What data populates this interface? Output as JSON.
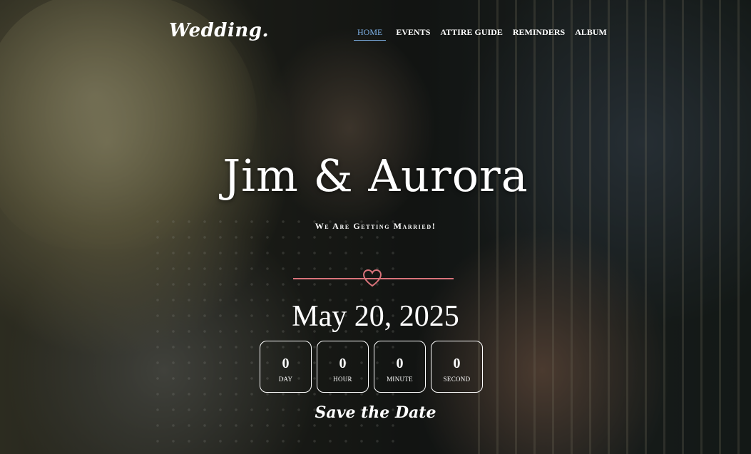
{
  "header": {
    "logo": "Wedding.",
    "nav": [
      {
        "label": "HOME",
        "active": true
      },
      {
        "label": "EVENTS",
        "active": false
      },
      {
        "label": "ATTIRE GUIDE",
        "active": false
      },
      {
        "label": "REMINDERS",
        "active": false
      },
      {
        "label": "ALBUM",
        "active": false
      }
    ]
  },
  "hero": {
    "names": "Jim & Aurora",
    "tagline": "We Are Getting Married!",
    "date": "May 20, 2025",
    "countdown": [
      {
        "value": "0",
        "label": "DAY"
      },
      {
        "value": "0",
        "label": "HOUR"
      },
      {
        "value": "0",
        "label": "MINUTE"
      },
      {
        "value": "0",
        "label": "SECOND"
      }
    ],
    "save_label": "Save the Date"
  },
  "colors": {
    "accent": "#d9737a",
    "nav_active": "#7fb2e8",
    "text": "#ffffff"
  },
  "icons": {
    "divider_icon": "heart-icon"
  }
}
